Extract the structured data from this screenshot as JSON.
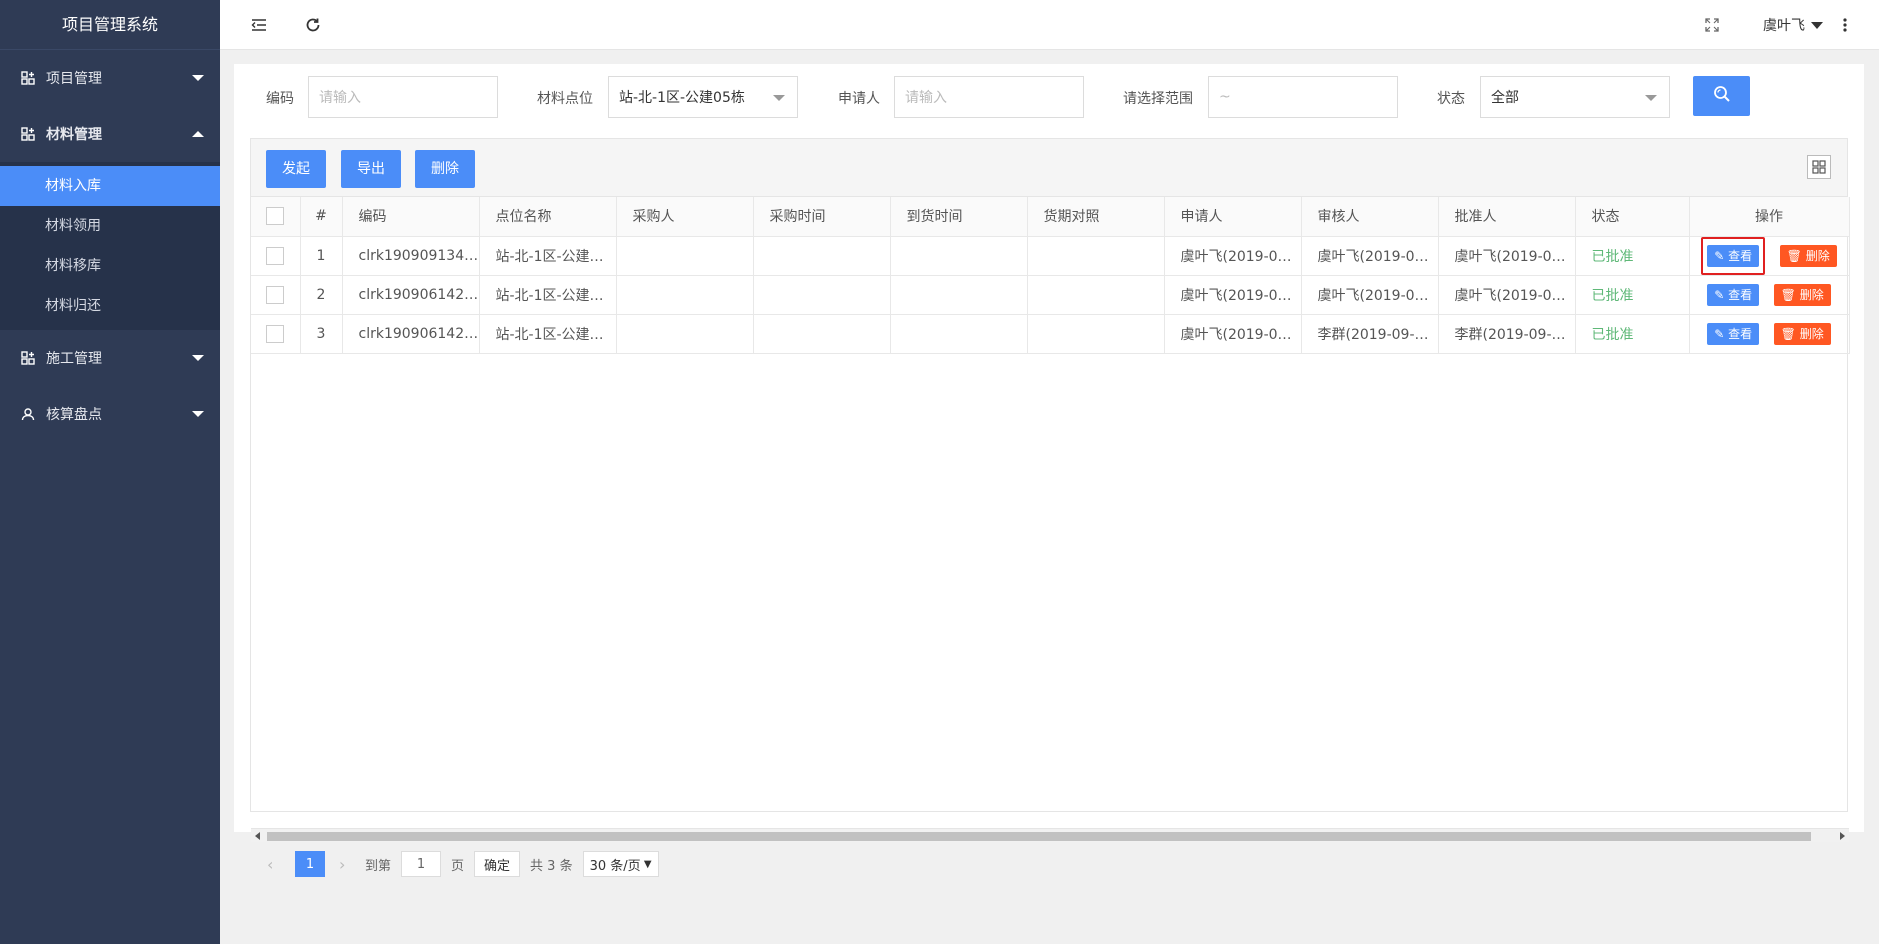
{
  "app": {
    "title": "项目管理系统"
  },
  "sidebar": {
    "items": [
      {
        "label": "项目管理"
      },
      {
        "label": "材料管理"
      },
      {
        "label": "施工管理"
      },
      {
        "label": "核算盘点"
      }
    ],
    "submenu": [
      {
        "label": "材料入库"
      },
      {
        "label": "材料领用"
      },
      {
        "label": "材料移库"
      },
      {
        "label": "材料归还"
      }
    ]
  },
  "header": {
    "user": "虞叶飞"
  },
  "filters": {
    "code_label": "编码",
    "code_placeholder": "请输入",
    "location_label": "材料点位",
    "location_value": "站-北-1区-公建05栋",
    "applicant_label": "申请人",
    "applicant_placeholder": "请输入",
    "range_label": "请选择范围",
    "range_placeholder": "~",
    "status_label": "状态",
    "status_value": "全部"
  },
  "toolbar": {
    "start": "发起",
    "export": "导出",
    "delete": "删除"
  },
  "table": {
    "headers": [
      "#",
      "编码",
      "点位名称",
      "采购人",
      "采购时间",
      "到货时间",
      "货期对照",
      "申请人",
      "审核人",
      "批准人",
      "状态",
      "操作"
    ],
    "rows": [
      {
        "no": "1",
        "code": "clrk190909134…",
        "location": "站-北-1区-公建…",
        "buyer": "",
        "buy_time": "",
        "arrive_time": "",
        "contrast": "",
        "applicant": "虞叶飞(2019-0…",
        "reviewer": "虞叶飞(2019-0…",
        "approver": "虞叶飞(2019-0…",
        "status": "已批准"
      },
      {
        "no": "2",
        "code": "clrk190906142…",
        "location": "站-北-1区-公建…",
        "buyer": "",
        "buy_time": "",
        "arrive_time": "",
        "contrast": "",
        "applicant": "虞叶飞(2019-0…",
        "reviewer": "虞叶飞(2019-0…",
        "approver": "虞叶飞(2019-0…",
        "status": "已批准"
      },
      {
        "no": "3",
        "code": "clrk190906142…",
        "location": "站-北-1区-公建…",
        "buyer": "",
        "buy_time": "",
        "arrive_time": "",
        "contrast": "",
        "applicant": "虞叶飞(2019-0…",
        "reviewer": "李群(2019-09-…",
        "approver": "李群(2019-09-…",
        "status": "已批准"
      }
    ],
    "view_label": "查看",
    "delete_label": "删除"
  },
  "pager": {
    "current": "1",
    "goto_label": "到第",
    "goto_value": "1",
    "page_label": "页",
    "confirm": "确定",
    "total": "共 3 条",
    "page_size": "30 条/页"
  }
}
